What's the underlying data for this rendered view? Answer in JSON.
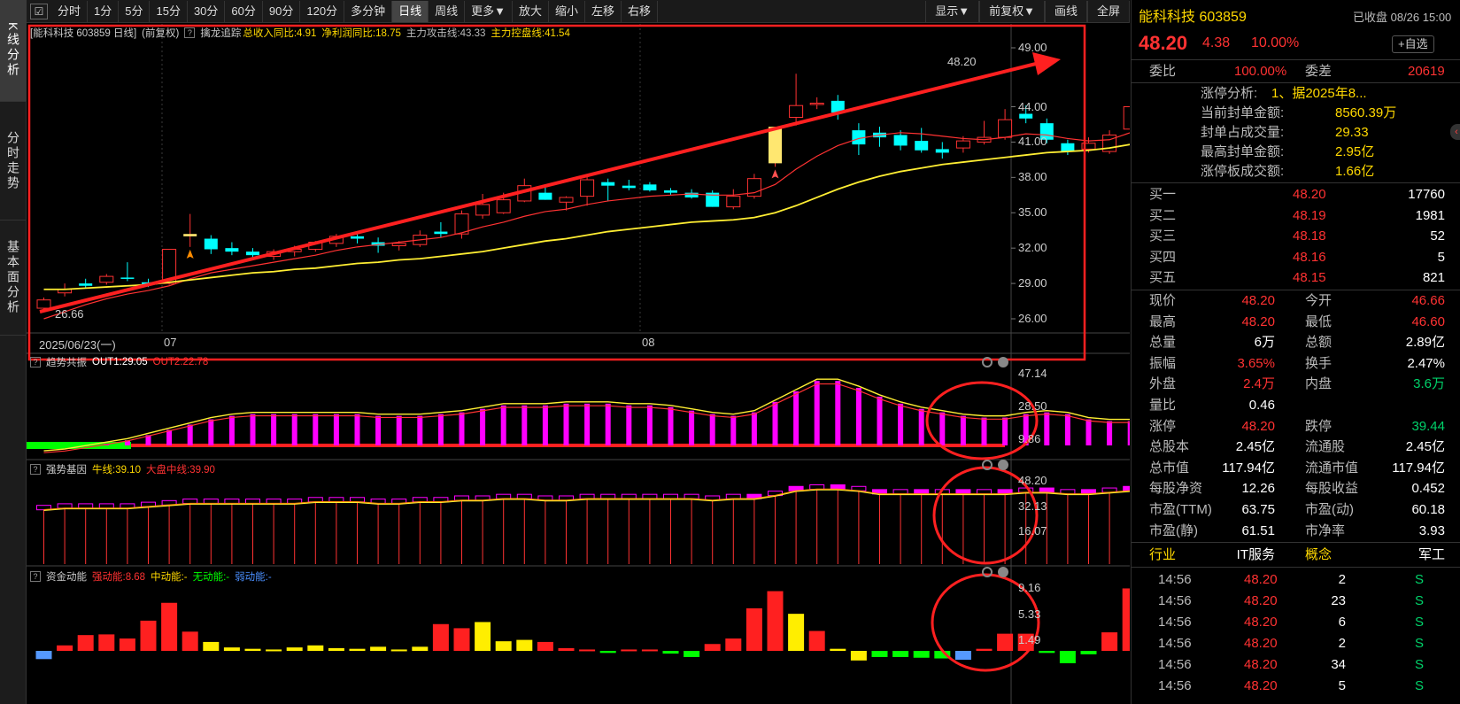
{
  "left_tabs": [
    "K线分析",
    "分时走势",
    "基本面分析"
  ],
  "toolbar": {
    "items": [
      "分时",
      "1分",
      "5分",
      "15分",
      "30分",
      "60分",
      "90分",
      "120分",
      "多分钟",
      "日线",
      "周线",
      "更多▼",
      "放大",
      "缩小",
      "左移",
      "右移"
    ],
    "active": "日线",
    "right": [
      "显示▼",
      "前复权▼",
      "画线",
      "全屏"
    ]
  },
  "kline": {
    "title": "[能科科技 603859 日线]",
    "fq": "(前复权)",
    "indicator": "擒龙追踪",
    "i1": "总收入同比:4.91",
    "i2": "净利润同比:18.75",
    "i3": "主力攻击线:43.33",
    "i4": "主力控盘线:41.54",
    "yticks": [
      "49.00",
      "44.00",
      "41.00",
      "38.00",
      "35.00",
      "32.00",
      "29.00",
      "26.00"
    ],
    "xlabels": [
      "2025/06/23(一)",
      "07",
      "08"
    ],
    "max_label": "48.20",
    "min_label": "26.66"
  },
  "p2": {
    "title": "趋势共振",
    "a": "OUT1:29.05",
    "b": "OUT2:22.78",
    "yticks": [
      "47.14",
      "28.50",
      "9.86"
    ]
  },
  "p3": {
    "title": "强势基因",
    "a": "牛线:39.10",
    "b": "大盘中线:39.90",
    "yticks": [
      "48.20",
      "32.13",
      "16.07"
    ]
  },
  "p4": {
    "title": "资金动能",
    "a": "强动能:8.68",
    "b": "中动能:-",
    "c": "无动能:-",
    "d": "弱动能:-",
    "yticks": [
      "9.16",
      "5.33",
      "1.49"
    ]
  },
  "chart_data": {
    "type": "candlestick",
    "series": [
      {
        "name": "K线",
        "ohlc": [
          [
            26.9,
            27.8,
            26.7,
            27.6
          ],
          [
            28.2,
            29.0,
            27.9,
            28.5
          ],
          [
            29.0,
            29.4,
            28.6,
            28.8
          ],
          [
            29.1,
            29.8,
            28.9,
            29.6
          ],
          [
            29.5,
            30.8,
            29.2,
            29.4
          ],
          [
            29.1,
            29.4,
            28.7,
            28.9
          ],
          [
            29.0,
            31.9,
            28.9,
            31.9
          ],
          [
            33.0,
            34.9,
            32.1,
            33.2
          ],
          [
            32.8,
            33.1,
            31.5,
            31.9
          ],
          [
            32.0,
            32.5,
            31.4,
            31.7
          ],
          [
            31.7,
            32.0,
            31.1,
            31.4
          ],
          [
            31.3,
            31.9,
            31.0,
            31.7
          ],
          [
            31.7,
            32.2,
            31.3,
            31.9
          ],
          [
            31.9,
            32.6,
            31.7,
            32.5
          ],
          [
            32.4,
            33.2,
            32.1,
            33.0
          ],
          [
            33.0,
            33.4,
            32.4,
            32.8
          ],
          [
            32.5,
            32.9,
            31.6,
            32.2
          ],
          [
            32.2,
            32.6,
            31.8,
            32.4
          ],
          [
            32.3,
            33.5,
            32.1,
            33.1
          ],
          [
            33.4,
            34.2,
            32.9,
            33.2
          ],
          [
            33.2,
            35.2,
            32.8,
            34.9
          ],
          [
            34.8,
            36.6,
            34.5,
            35.7
          ],
          [
            35.0,
            36.7,
            34.9,
            36.1
          ],
          [
            36.0,
            37.9,
            35.9,
            37.3
          ],
          [
            36.7,
            37.3,
            36.1,
            36.1
          ],
          [
            35.9,
            36.4,
            35.2,
            36.3
          ],
          [
            36.4,
            38.1,
            35.6,
            37.8
          ],
          [
            37.6,
            37.9,
            36.0,
            37.3
          ],
          [
            37.3,
            37.8,
            36.9,
            37.1
          ],
          [
            37.4,
            37.6,
            36.8,
            36.9
          ],
          [
            36.9,
            37.1,
            36.5,
            36.7
          ],
          [
            36.7,
            37.0,
            36.2,
            36.3
          ],
          [
            36.7,
            36.9,
            35.5,
            35.5
          ],
          [
            35.5,
            37.0,
            35.3,
            36.4
          ],
          [
            36.4,
            38.3,
            36.2,
            37.9
          ],
          [
            39.2,
            42.3,
            38.9,
            42.3
          ],
          [
            43.1,
            46.8,
            42.4,
            44.1
          ],
          [
            44.3,
            44.8,
            43.8,
            44.3
          ],
          [
            44.5,
            45.0,
            42.9,
            43.5
          ],
          [
            42.0,
            42.6,
            39.9,
            40.8
          ],
          [
            41.8,
            42.3,
            40.6,
            41.4
          ],
          [
            41.6,
            42.0,
            40.3,
            40.7
          ],
          [
            41.1,
            42.2,
            40.1,
            40.3
          ],
          [
            40.4,
            41.0,
            39.6,
            40.1
          ],
          [
            40.5,
            41.5,
            40.1,
            41.1
          ],
          [
            41.0,
            42.8,
            40.8,
            41.4
          ],
          [
            41.4,
            43.8,
            41.2,
            42.9
          ],
          [
            43.4,
            44.1,
            42.6,
            43.0
          ],
          [
            42.6,
            43.0,
            40.9,
            41.2
          ],
          [
            40.9,
            41.2,
            39.9,
            40.2
          ],
          [
            40.4,
            41.4,
            40.1,
            40.9
          ],
          [
            40.2,
            42.0,
            40.0,
            41.6
          ],
          [
            42.1,
            44.5,
            41.9,
            44.0
          ],
          [
            46.7,
            48.2,
            46.6,
            48.2
          ]
        ]
      },
      {
        "name": "主力攻击线",
        "values": [
          26.0,
          26.6,
          27.2,
          27.7,
          28.1,
          28.4,
          28.8,
          29.4,
          29.9,
          30.2,
          30.5,
          30.8,
          31.1,
          31.4,
          31.8,
          32.1,
          32.3,
          32.5,
          32.7,
          32.9,
          33.3,
          33.8,
          34.2,
          34.7,
          35.1,
          35.3,
          35.7,
          36.0,
          36.2,
          36.4,
          36.5,
          36.6,
          36.5,
          36.5,
          36.7,
          37.4,
          38.7,
          39.8,
          40.7,
          41.3,
          41.6,
          41.8,
          41.7,
          41.5,
          41.3,
          41.2,
          41.4,
          41.7,
          41.6,
          41.3,
          41.1,
          41.2,
          41.8,
          43.3
        ]
      },
      {
        "name": "主力控盘线",
        "values": [
          28.5,
          28.5,
          28.6,
          28.7,
          28.8,
          28.9,
          29.1,
          29.3,
          29.5,
          29.7,
          29.9,
          30.0,
          30.2,
          30.3,
          30.5,
          30.7,
          30.8,
          31.0,
          31.1,
          31.3,
          31.5,
          31.7,
          32.0,
          32.3,
          32.6,
          32.8,
          33.1,
          33.4,
          33.6,
          33.8,
          34.0,
          34.2,
          34.3,
          34.4,
          34.6,
          35.0,
          35.6,
          36.3,
          37.0,
          37.6,
          38.1,
          38.5,
          38.8,
          39.1,
          39.3,
          39.5,
          39.7,
          39.9,
          40.1,
          40.2,
          40.3,
          40.5,
          40.8,
          41.5
        ]
      },
      {
        "name": "趋势共振",
        "values": [
          2,
          3,
          5,
          7,
          9,
          12,
          15,
          18,
          21,
          23,
          24,
          24,
          24,
          24,
          24,
          24,
          23,
          23,
          23,
          24,
          25,
          27,
          29,
          29,
          29,
          30,
          30,
          30,
          29,
          29,
          28,
          26,
          24,
          23,
          25,
          31,
          37,
          43,
          43,
          39,
          34,
          30,
          27,
          25,
          23,
          22,
          22,
          24,
          25,
          24,
          21,
          20,
          20,
          22,
          28.5
        ]
      },
      {
        "name": "强势基因",
        "values": [
          31,
          32,
          32,
          32,
          32,
          33,
          34,
          35,
          35,
          35,
          35,
          35,
          35,
          36,
          36,
          36,
          35,
          35,
          36,
          36,
          37,
          37,
          38,
          38,
          37,
          37,
          38,
          38,
          38,
          38,
          38,
          38,
          37,
          38,
          38,
          40,
          43,
          44,
          44,
          43,
          41,
          41,
          41,
          41,
          41,
          41,
          41,
          42,
          42,
          41,
          41,
          42,
          43,
          46
        ]
      },
      {
        "name": "资金动能",
        "values": [
          -1.2,
          0.8,
          2.3,
          2.4,
          1.8,
          4.4,
          7.0,
          2.8,
          1.3,
          0.5,
          0.3,
          0.2,
          0.5,
          0.8,
          0.4,
          0.3,
          0.6,
          0.2,
          0.6,
          3.9,
          3.3,
          4.2,
          1.4,
          1.6,
          1.3,
          0.4,
          0.2,
          -0.3,
          0.2,
          0.2,
          -0.4,
          -0.9,
          1.0,
          1.8,
          6.2,
          8.7,
          5.4,
          2.9,
          0.3,
          -1.4,
          -0.9,
          -0.9,
          -1.0,
          -1.1,
          -1.3,
          0.3,
          2.5,
          2.5,
          -0.3,
          -1.8,
          -0.5,
          2.7,
          9.1
        ]
      }
    ]
  },
  "quote": {
    "name": "能科科技 603859",
    "status": "已收盘 08/26 15:00",
    "price": "48.20",
    "change": "4.38",
    "pct": "10.00%",
    "fav": "+自选",
    "weibi_label": "委比",
    "weibi": "100.00%",
    "weicha_label": "委差",
    "weicha": "20619",
    "zt": [
      [
        "涨停分析:",
        "1、据2025年8..."
      ],
      [
        "当前封单金额:",
        "8560.39万"
      ],
      [
        "封单占成交量:",
        "29.33"
      ],
      [
        "最高封单金额:",
        "2.95亿"
      ],
      [
        "涨停板成交额:",
        "1.66亿"
      ]
    ],
    "buy": [
      [
        "买一",
        "48.20",
        "17760"
      ],
      [
        "买二",
        "48.19",
        "1981"
      ],
      [
        "买三",
        "48.18",
        "52"
      ],
      [
        "买四",
        "48.16",
        "5"
      ],
      [
        "买五",
        "48.15",
        "821"
      ]
    ],
    "stats": [
      [
        "现价",
        "48.20",
        "今开",
        "46.66"
      ],
      [
        "最高",
        "48.20",
        "最低",
        "46.60"
      ],
      [
        "总量",
        "6万",
        "总额",
        "2.89亿"
      ],
      [
        "振幅",
        "3.65%",
        "换手",
        "2.47%"
      ],
      [
        "外盘",
        "2.4万",
        "内盘",
        "3.6万"
      ],
      [
        "量比",
        "0.46",
        "",
        ""
      ],
      [
        "涨停",
        "48.20",
        "跌停",
        "39.44"
      ],
      [
        "总股本",
        "2.45亿",
        "流通股",
        "2.45亿"
      ],
      [
        "总市值",
        "117.94亿",
        "流通市值",
        "117.94亿"
      ],
      [
        "每股净资",
        "12.26",
        "每股收益",
        "0.452"
      ],
      [
        "市盈(TTM)",
        "63.75",
        "市盈(动)",
        "60.18"
      ],
      [
        "市盈(静)",
        "61.51",
        "市净率",
        "3.93"
      ]
    ],
    "industry_label": "行业",
    "industry": "IT服务",
    "concept_label": "概念",
    "concept": "军工",
    "ticks": [
      [
        "14:56",
        "48.20",
        "2",
        "S"
      ],
      [
        "14:56",
        "48.20",
        "23",
        "S"
      ],
      [
        "14:56",
        "48.20",
        "6",
        "S"
      ],
      [
        "14:56",
        "48.20",
        "2",
        "S"
      ],
      [
        "14:56",
        "48.20",
        "34",
        "S"
      ],
      [
        "14:56",
        "48.20",
        "5",
        "S"
      ]
    ]
  }
}
